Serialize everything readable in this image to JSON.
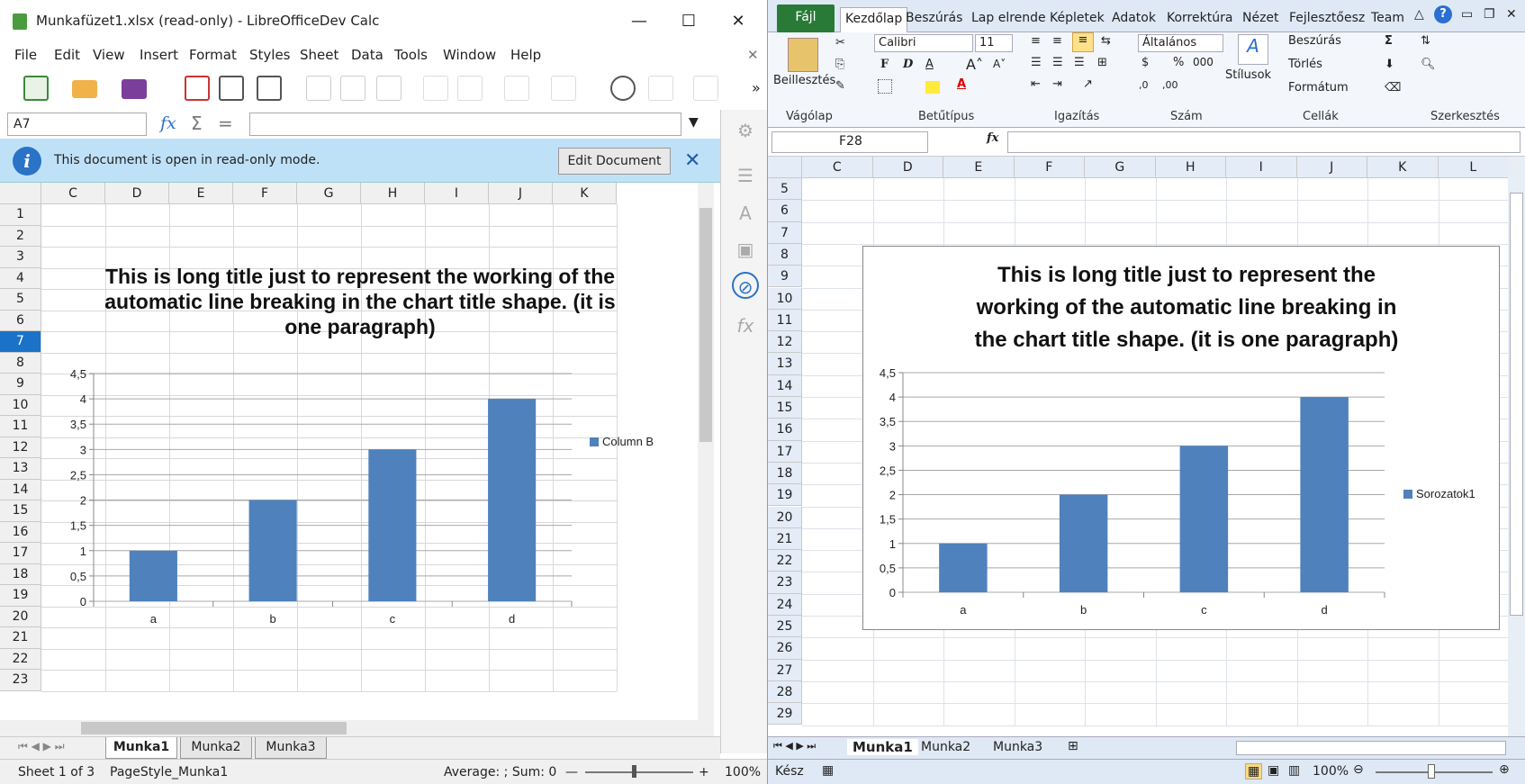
{
  "lo": {
    "title": "Munkafüzet1.xlsx (read-only) - LibreOfficeDev Calc",
    "menu": [
      "File",
      "Edit",
      "View",
      "Insert",
      "Format",
      "Styles",
      "Sheet",
      "Data",
      "Tools",
      "Window",
      "Help"
    ],
    "name_box": "A7",
    "info_message": "This document is open in read-only mode.",
    "edit_button": "Edit Document",
    "columns": [
      "C",
      "D",
      "E",
      "F",
      "G",
      "H",
      "I",
      "J",
      "K"
    ],
    "rows": [
      "1",
      "2",
      "3",
      "4",
      "5",
      "6",
      "7",
      "8",
      "9",
      "10",
      "11",
      "12",
      "13",
      "14",
      "15",
      "16",
      "17",
      "18",
      "19",
      "20",
      "21",
      "22",
      "23"
    ],
    "sheet_tabs": [
      "Munka1",
      "Munka2",
      "Munka3"
    ],
    "status": {
      "sheet": "Sheet 1 of 3",
      "style": "PageStyle_Munka1",
      "sum": "Average: ; Sum: 0",
      "zoom": "100%"
    }
  },
  "xl": {
    "file_tab": "Fájl",
    "tabs": [
      "Kezdőlap",
      "Beszúrás",
      "Lap elrende",
      "Képletek",
      "Adatok",
      "Korrektúra",
      "Nézet",
      "Fejlesztőesz",
      "Team"
    ],
    "ribbon": {
      "paste": "Beillesztés",
      "font_name": "Calibri",
      "font_size": "11",
      "number_format": "Általános",
      "styles": "Stílusok",
      "insert": "Beszúrás",
      "delete": "Törlés",
      "format": "Formátum",
      "groups": [
        "Vágólap",
        "Betűtípus",
        "Igazítás",
        "Szám",
        "Cellák",
        "Szerkesztés"
      ]
    },
    "name_box": "F28",
    "columns": [
      "C",
      "D",
      "E",
      "F",
      "G",
      "H",
      "I",
      "J",
      "K",
      "L"
    ],
    "rows": [
      "5",
      "6",
      "7",
      "8",
      "9",
      "10",
      "11",
      "12",
      "13",
      "14",
      "15",
      "16",
      "17",
      "18",
      "19",
      "20",
      "21",
      "22",
      "23",
      "24",
      "25",
      "26",
      "27",
      "28",
      "29"
    ],
    "sheet_tabs": [
      "Munka1",
      "Munka2",
      "Munka3"
    ],
    "status": {
      "ready": "Kész",
      "zoom": "100%"
    }
  },
  "chart_data": [
    {
      "type": "bar",
      "title": "This is long title just to represent the working of the automatic line breaking in the chart title shape. (it is one paragraph)",
      "title_lines": [
        "This is long title just to represent the working of the",
        "automatic line breaking in the chart title shape. (it is",
        "one paragraph)"
      ],
      "categories": [
        "a",
        "b",
        "c",
        "d"
      ],
      "series": [
        {
          "name": "Column B",
          "values": [
            1,
            2,
            3,
            4
          ]
        }
      ],
      "yticks": [
        "0",
        "0,5",
        "1",
        "1,5",
        "2",
        "2,5",
        "3",
        "3,5",
        "4",
        "4,5"
      ],
      "ylim": [
        0,
        4.5
      ],
      "grid": true,
      "legend": "right",
      "color": "#4f81bd"
    },
    {
      "type": "bar",
      "title": "This is long title just to represent the working of the automatic line breaking in the chart title shape. (it is one paragraph)",
      "title_lines": [
        "This is long title just to represent the",
        "working of the automatic line breaking in",
        "the chart title shape. (it is one paragraph)"
      ],
      "categories": [
        "a",
        "b",
        "c",
        "d"
      ],
      "series": [
        {
          "name": "Sorozatok1",
          "values": [
            1,
            2,
            3,
            4
          ]
        }
      ],
      "yticks": [
        "0",
        "0,5",
        "1",
        "1,5",
        "2",
        "2,5",
        "3",
        "3,5",
        "4",
        "4,5"
      ],
      "ylim": [
        0,
        4.5
      ],
      "grid": true,
      "legend": "right",
      "color": "#4f81bd"
    }
  ]
}
